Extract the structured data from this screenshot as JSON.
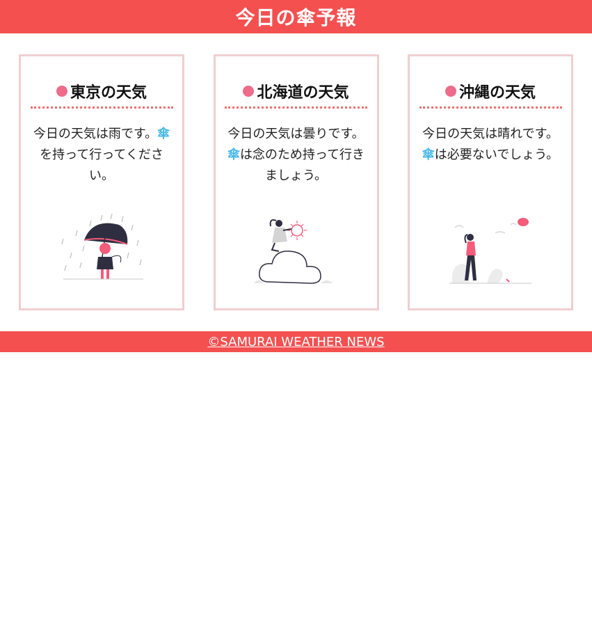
{
  "header": {
    "title": "今日の傘予報"
  },
  "cards": [
    {
      "title": "東京の天気",
      "line1": "今日の天気は雨です。",
      "umbrella": "傘",
      "line2": "を持って行ってください。",
      "illustration": "rain-umbrella-illustration"
    },
    {
      "title": "北海道の天気",
      "line1": "今日の天気は曇りです。",
      "umbrella": "傘",
      "line2": "は念のため持って行きましょう。",
      "illustration": "cloud-illustration"
    },
    {
      "title": "沖縄の天気",
      "line1": "今日の天気は晴れです。",
      "umbrella": "傘",
      "line2": "は必要ないでしょう。",
      "illustration": "sunny-walk-illustration"
    }
  ],
  "footer": {
    "text": "©SAMURAI WEATHER NEWS"
  },
  "colors": {
    "accent": "#f45050",
    "card_border": "#efcfd1",
    "dot": "#ee6c89",
    "umbrella_text": "#48b9e8"
  }
}
